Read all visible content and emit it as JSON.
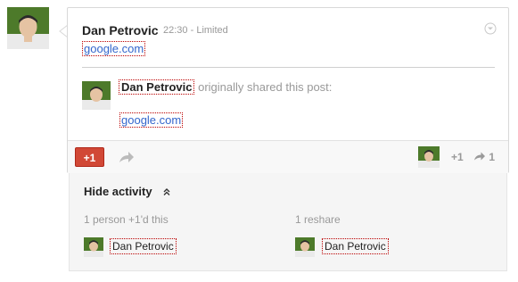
{
  "post": {
    "author": "Dan Petrovic",
    "time": "22:30",
    "separator": "-",
    "visibility": "Limited",
    "link": "google.com"
  },
  "shared": {
    "author": "Dan Petrovic",
    "text": " originally shared this post:",
    "link": "google.com"
  },
  "actions": {
    "plusone_label": "+1",
    "plus_count": "+1",
    "reshare_count": "1"
  },
  "activity": {
    "toggle_label": "Hide activity",
    "plusones_text": "1 person +1'd this",
    "reshares_text": "1 reshare",
    "plusone_person": "Dan Petrovic",
    "reshare_person": "Dan Petrovic"
  },
  "colors": {
    "link": "#3366cc",
    "plusone_button": "#d14836",
    "avatar_bg": "#4d7a2a"
  },
  "icons": [
    "avatar",
    "caret-down-icon",
    "share-arrow-icon",
    "chevron-up-icon"
  ]
}
